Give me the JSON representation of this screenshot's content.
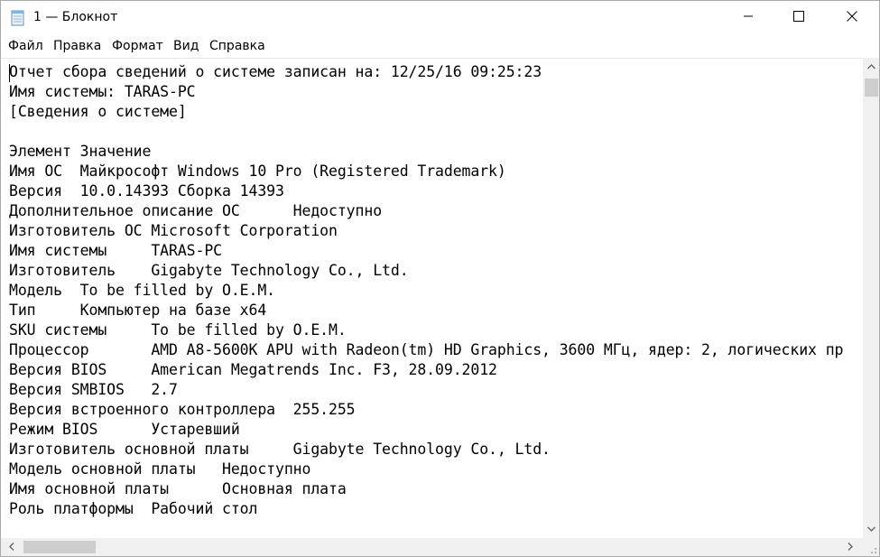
{
  "window": {
    "title": "1 — Блокнот",
    "icons": {
      "app": "notepad-icon",
      "minimize": "minimize-icon",
      "maximize": "maximize-icon",
      "close": "close-icon"
    }
  },
  "menu": {
    "items": [
      "Файл",
      "Правка",
      "Формат",
      "Вид",
      "Справка"
    ]
  },
  "document": {
    "lines": [
      "Отчет сбора сведений о системе записан на: 12/25/16 09:25:23",
      "Имя системы: TARAS-PC",
      "[Сведения о системе]",
      "",
      "Элемент Значение",
      "Имя ОС  Майкрософт Windows 10 Pro (Registered Trademark)",
      "Версия  10.0.14393 Сборка 14393",
      "Дополнительное описание ОС      Недоступно",
      "Изготовитель ОС Microsoft Corporation",
      "Имя системы     TARAS-PC",
      "Изготовитель    Gigabyte Technology Co., Ltd.",
      "Модель  To be filled by O.E.M.",
      "Тип     Компьютер на базе x64",
      "SKU системы     To be filled by O.E.M.",
      "Процессор       AMD A8-5600K APU with Radeon(tm) HD Graphics, 3600 МГц, ядер: 2, логических пр",
      "Версия BIOS     American Megatrends Inc. F3, 28.09.2012",
      "Версия SMBIOS   2.7",
      "Версия встроенного контроллера  255.255",
      "Режим BIOS      Устаревший",
      "Изготовитель основной платы     Gigabyte Technology Co., Ltd.",
      "Модель основной платы   Недоступно",
      "Имя основной платы      Основная плата",
      "Роль платформы  Рабочий стол"
    ]
  },
  "scrollbars": {
    "icons": {
      "up": "scroll-up-arrow-icon",
      "down": "scroll-down-arrow-icon",
      "left": "scroll-left-arrow-icon",
      "right": "scroll-right-arrow-icon"
    }
  }
}
